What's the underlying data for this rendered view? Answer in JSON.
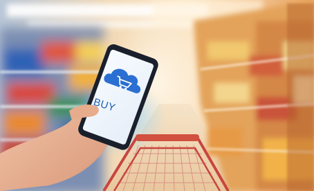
{
  "photo": {
    "subject": "smartphone-shopping-in-supermarket",
    "phone_screen": {
      "icon": "cart-cloud-icon",
      "label": "BUY"
    },
    "colors": {
      "aisle_warm": "#e7b36a",
      "shelf_blue": "#3a6fb0",
      "cart_red": "#c8453e",
      "screen_blue": "#2a6fd1",
      "skin": "#e9b594"
    }
  }
}
